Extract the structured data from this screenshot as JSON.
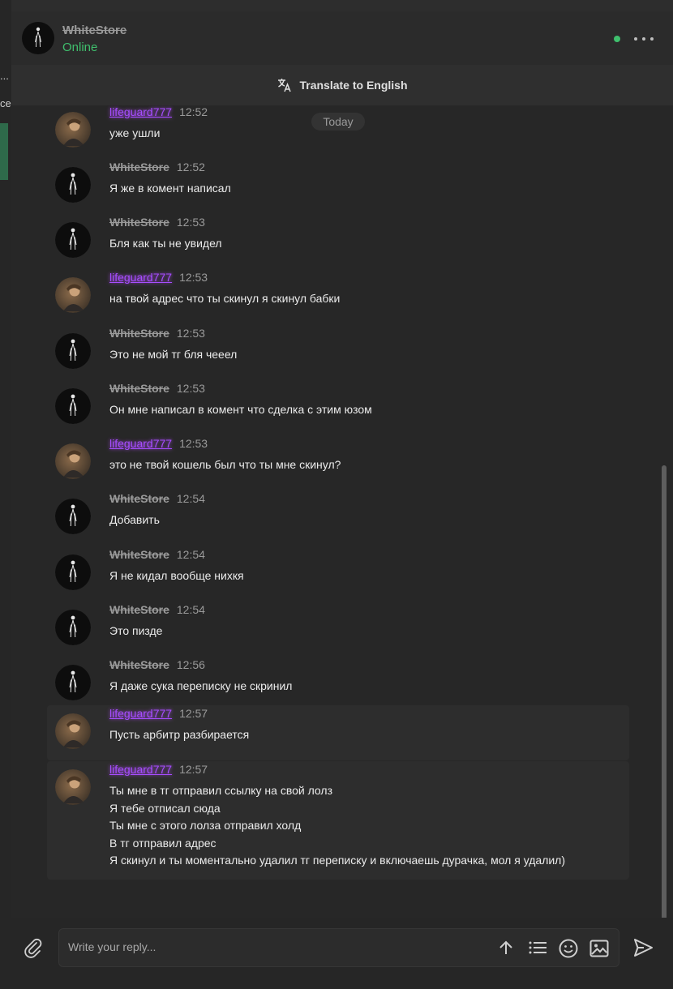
{
  "window": {
    "contact_name": "WhiteStore",
    "contact_status": "Online",
    "translate_label": "Translate to English"
  },
  "behind_window_text": [
    "...",
    "ce"
  ],
  "date_separator": "Today",
  "colors": {
    "online_green": "#3fbf6d",
    "username_purple": "#a64dff",
    "background": "#272727"
  },
  "messages": [
    {
      "author": "lifeguard777",
      "time": "12:52",
      "lines": [
        "уже ушли"
      ]
    },
    {
      "author": "WhiteStore",
      "time": "12:52",
      "lines": [
        "Я же в комент написал"
      ]
    },
    {
      "author": "WhiteStore",
      "time": "12:53",
      "lines": [
        "Бля как ты не увидел"
      ]
    },
    {
      "author": "lifeguard777",
      "time": "12:53",
      "lines": [
        "на твой адрес что ты скинул я скинул бабки"
      ]
    },
    {
      "author": "WhiteStore",
      "time": "12:53",
      "lines": [
        "Это не мой тг бля чееел"
      ]
    },
    {
      "author": "WhiteStore",
      "time": "12:53",
      "lines": [
        "Он мне написал в комент что сделка с этим юзом"
      ]
    },
    {
      "author": "lifeguard777",
      "time": "12:53",
      "lines": [
        "это не твой кошель был что ты мне скинул?"
      ]
    },
    {
      "author": "WhiteStore",
      "time": "12:54",
      "lines": [
        "Добавить"
      ]
    },
    {
      "author": "WhiteStore",
      "time": "12:54",
      "lines": [
        "Я не кидал вообще нихкя"
      ]
    },
    {
      "author": "WhiteStore",
      "time": "12:54",
      "lines": [
        "Это пизде"
      ]
    },
    {
      "author": "WhiteStore",
      "time": "12:56",
      "lines": [
        "Я даже сука переписку не скринил"
      ]
    },
    {
      "author": "lifeguard777",
      "time": "12:57",
      "lines": [
        "Пусть арбитр разбирается"
      ]
    },
    {
      "author": "lifeguard777",
      "time": "12:57",
      "lines": [
        "Ты мне в тг отправил ссылку на свой лолз",
        "Я тебе отписал сюда",
        "Ты мне с этого лолза отправил холд",
        "В тг отправил адрес",
        "Я скинул и ты моментально удалил тг переписку и включаешь дурачка, мол я удалил)"
      ]
    }
  ],
  "composer": {
    "placeholder": "Write your reply...",
    "icons": [
      "paperclip-icon",
      "arrow-up-icon",
      "list-icon",
      "emoji-icon",
      "image-icon",
      "send-icon"
    ]
  }
}
